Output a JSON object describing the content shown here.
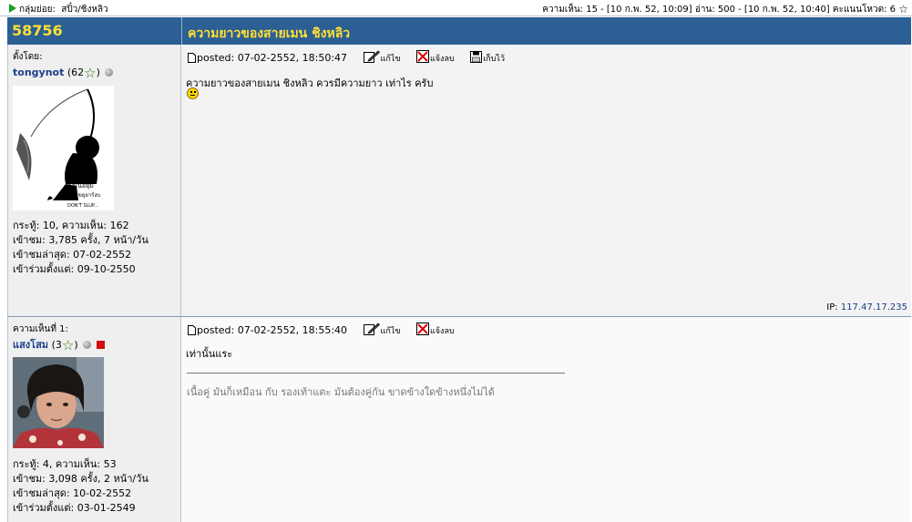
{
  "topbar": {
    "subgroup_label": "กลุ่มย่อย:",
    "subgroup_value": "สปิ๋ว/ชิงหลิว",
    "stats": "ความเห็น: 15 - [10 ก.พ. 52, 10:09] อ่าน: 500 - [10 ก.พ. 52, 10:40] คะแนนโหวต: 6"
  },
  "header": {
    "topic_number": "58756",
    "topic_title": "ความยาวของสายเมน ชิงหลิว"
  },
  "posts": [
    {
      "role_label": "ตั้งโดย:",
      "username": "tongynot",
      "rank": "(62",
      "stats": [
        "กระทู้: 10, ความเห็น: 162",
        "เข้าชม: 3,785 ครั้ง, 7 หน้า/วัน",
        "เข้าชมล่าสุด: 07-02-2552",
        "เข้าร่วมตั้งแต่: 09-10-2550"
      ],
      "posted": "posted: 07-02-2552, 18:50:47",
      "edit_label": "แก้ไข",
      "report_label": "แจ้งลบ",
      "save_label": "เก็บไว้",
      "body": "ความยาวของสายเมน ชิงหลิว ควรมีความยาว เท่าไร ครับ",
      "ip_label": "IP: ",
      "ip_value": "117.47.17.235",
      "avatar_caption": [
        "ต่อเนื่อยุ่ม",
        "ศพิษเขยุยาร์งบ",
        "DON'T SLUP..."
      ]
    },
    {
      "role_label": "ความเห็นที่ 1:",
      "username": "แสงโสม",
      "rank": "(3",
      "stats": [
        "กระทู้: 4, ความเห็น: 53",
        "เข้าชม: 3,098 ครั้ง, 2 หน้า/วัน",
        "เข้าชมล่าสุด: 10-02-2552",
        "เข้าร่วมตั้งแต่: 03-01-2549"
      ],
      "posted": "posted: 07-02-2552, 18:55:40",
      "edit_label": "แก้ไข",
      "report_label": "แจ้งลบ",
      "body": "เท่านั้นแระ",
      "signature": "เนื้อคู่ มันก็เหมือน กับ รองเท้าแตะ มันต้องคู่กัน ขาดข้างใดข้างหนึ่งไม่ได้"
    }
  ]
}
